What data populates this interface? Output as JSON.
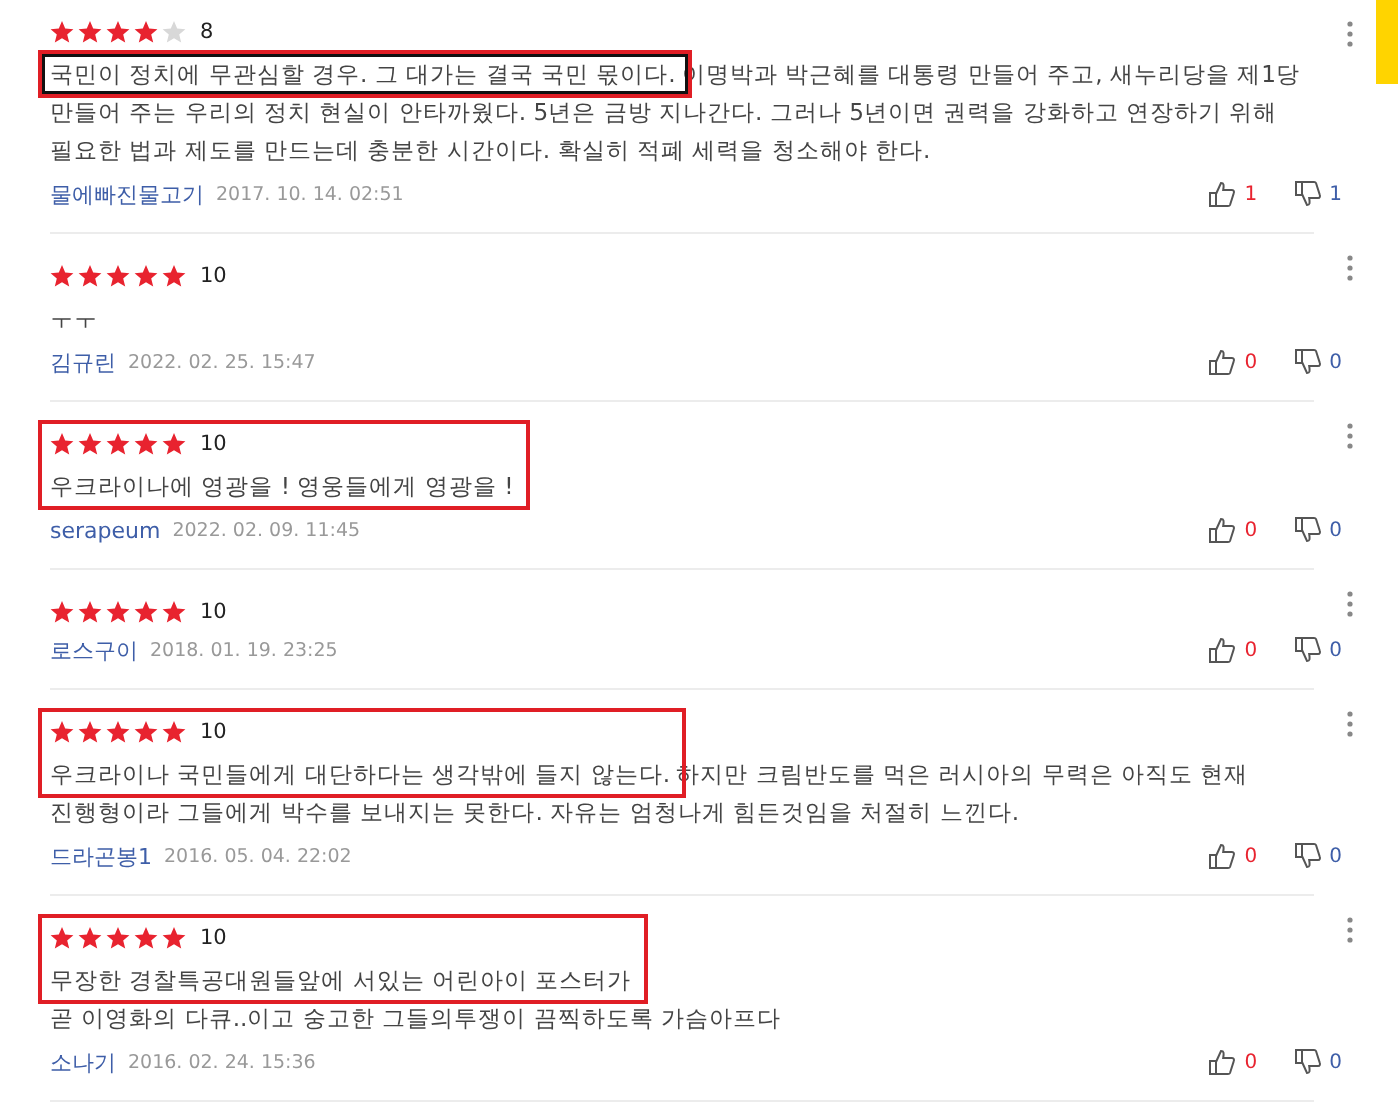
{
  "reviews": [
    {
      "stars": 4,
      "score": "8",
      "framed": true,
      "stars_framed": false,
      "lead": "국민이 정치에 무관심할 경우. 그 대가는 결국 국민 몫이다.",
      "lines": [
        "이명박과 박근혜를 대통령 만들어 주고, 새누리당을 제1당",
        "만들어 주는 우리의 정치 현실이 안타까웠다. 5년은 금방 지나간다. 그러나 5년이면 권력을 강화하고 연장하기 위해",
        "필요한 법과 제도를 만드는데 충분한 시간이다. 확실히 적폐 세력을 청소해야 한다."
      ],
      "author": "물에빠진물고기",
      "date": "2017. 10. 14. 02:51",
      "likes": "1",
      "dislikes": "1"
    },
    {
      "stars": 5,
      "score": "10",
      "framed": false,
      "stars_framed": false,
      "lead": "ㅜㅜ",
      "author": "김규린",
      "date": "2022. 02. 25. 15:47",
      "likes": "0",
      "dislikes": "0"
    },
    {
      "stars": 5,
      "score": "10",
      "framed": true,
      "stars_framed": true,
      "lead": "우크라이나에 영광을 ! 영웅들에게 영광을 !",
      "author": "serapeum",
      "date": "2022. 02. 09. 11:45",
      "likes": "0",
      "dislikes": "0"
    },
    {
      "stars": 5,
      "score": "10",
      "framed": false,
      "stars_framed": false,
      "author": "로스구이",
      "date": "2018. 01. 19. 23:25",
      "likes": "0",
      "dislikes": "0"
    },
    {
      "stars": 5,
      "score": "10",
      "framed": true,
      "stars_framed": true,
      "lead": "우크라이나 국민들에게 대단하다는 생각밖에 들지 않는다.",
      "lines": [
        "하지만 크림반도를 먹은 러시아의 무력은 아직도 현재",
        "진행형이라 그들에게 박수를 보내지는 못한다. 자유는 엄청나게 힘든것임을 처절히 느낀다."
      ],
      "author": "드라곤봉1",
      "date": "2016. 05. 04. 22:02",
      "likes": "0",
      "dislikes": "0"
    },
    {
      "stars": 5,
      "score": "10",
      "framed": true,
      "stars_framed": true,
      "lead": "무장한 경찰특공대원들앞에 서있는 어린아이 포스터가",
      "next_lines": [
        "곧 이영화의 다큐..이고 숭고한 그들의투쟁이 끔찍하도록 가슴아프다"
      ],
      "author": "소나기",
      "date": "2016. 02. 24. 15:36",
      "likes": "0",
      "dislikes": "0"
    }
  ]
}
